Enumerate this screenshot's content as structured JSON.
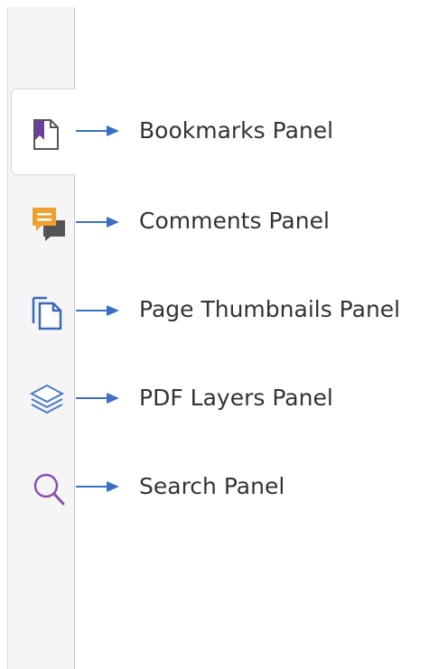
{
  "sidebar": {
    "items": [
      {
        "id": "bookmarks",
        "icon": "bookmark-icon",
        "label": "Bookmarks Panel",
        "active": true
      },
      {
        "id": "comments",
        "icon": "comments-icon",
        "label": "Comments Panel",
        "active": false
      },
      {
        "id": "thumbnails",
        "icon": "page-thumbnails-icon",
        "label": "Page Thumbnails Panel",
        "active": false
      },
      {
        "id": "layers",
        "icon": "layers-icon",
        "label": "PDF Layers Panel",
        "active": false
      },
      {
        "id": "search",
        "icon": "search-icon",
        "label": "Search Panel",
        "active": false
      }
    ]
  },
  "colors": {
    "arrow": "#3b6fc4",
    "bookmark": "#6b3fa0",
    "comments_primary": "#f0a030",
    "comments_secondary": "#555555",
    "thumbnails": "#3a6ab8",
    "layers": "#4a7ac8",
    "search": "#8a4fb0",
    "label_text": "#333333"
  }
}
